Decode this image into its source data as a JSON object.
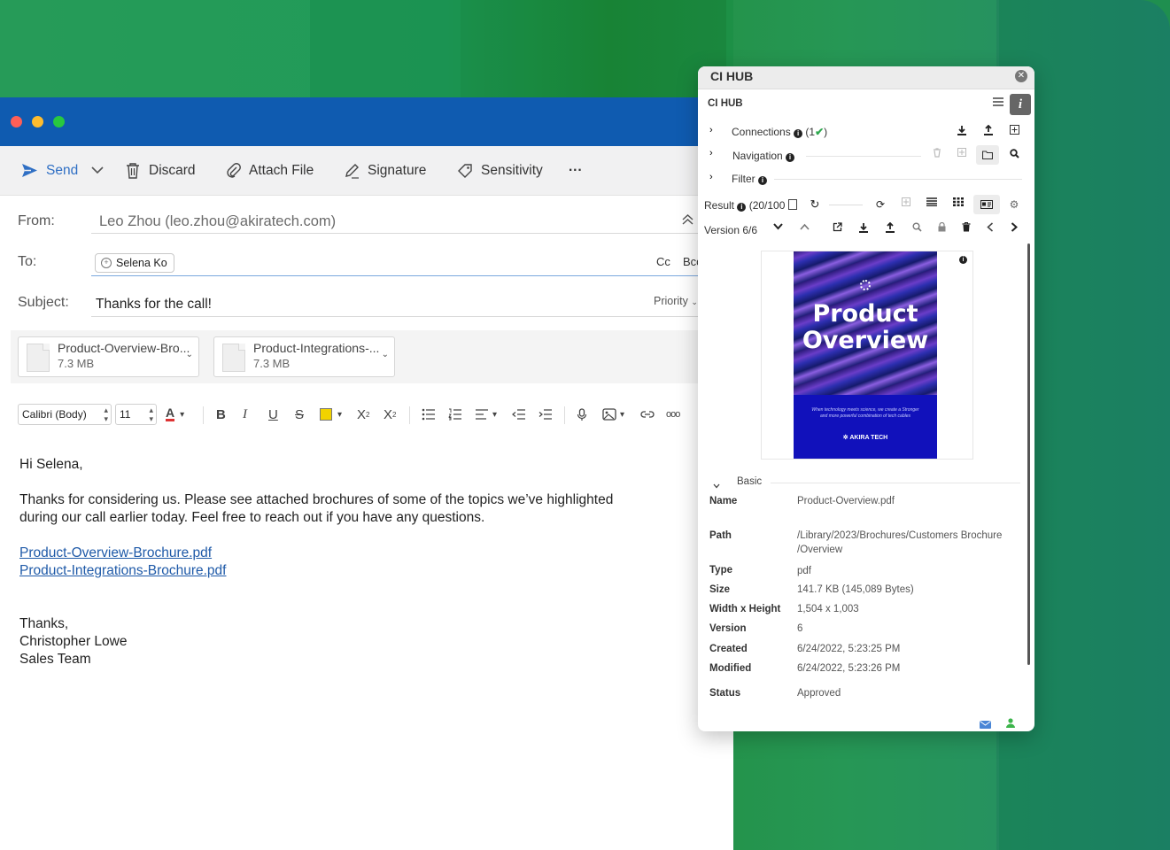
{
  "mail": {
    "toolbar": {
      "send": "Send",
      "discard": "Discard",
      "attach": "Attach File",
      "signature": "Signature",
      "sensitivity": "Sensitivity",
      "more": "···"
    },
    "from": {
      "label": "From:",
      "value": "Leo Zhou (leo.zhou@akiratech.com)"
    },
    "to": {
      "label": "To:",
      "recipient": "Selena Ko",
      "cc": "Cc",
      "bcc": "Bcc"
    },
    "subject": {
      "label": "Subject:",
      "value": "Thanks for the call!",
      "priority": "Priority"
    },
    "attachments": [
      {
        "name": "Product-Overview-Bro...",
        "size": "7.3 MB"
      },
      {
        "name": "Product-Integrations-...",
        "size": "7.3 MB"
      }
    ],
    "format": {
      "font": "Calibri (Body)",
      "size": "11"
    },
    "body": {
      "greeting": "Hi Selena,",
      "line1": "Thanks for considering us. Please see attached brochures of some of the topics we’ve highlighted",
      "line2": "during our call earlier today. Feel free to reach out if you have any questions.",
      "link1": "Product-Overview-Brochure.pdf",
      "link2": "Product-Integrations-Brochure.pdf",
      "closing": "Thanks,",
      "name": "Christopher Lowe",
      "team": "Sales Team"
    }
  },
  "hub": {
    "window_title": "CI HUB",
    "title": "CI HUB",
    "connections": "Connections",
    "connections_count": "(1",
    "connections_close": ")",
    "navigation": "Navigation",
    "filter": "Filter",
    "result": "Result",
    "result_count": "(20/100",
    "version": "Version 6/6",
    "preview": {
      "title_line1": "Product",
      "title_line2": "Overview",
      "tagline": "When technology meets science, we create a Stronger and more powerful combination of tech cables",
      "brand": "AKIRA TECH"
    },
    "section": "Basic",
    "meta": [
      {
        "key": "Name",
        "value": "Product-Overview.pdf"
      },
      {
        "key": "Path",
        "value": "/Library/2023/Brochures/Customers Brochure"
      },
      {
        "key": "",
        "value": "/Overview"
      },
      {
        "key": "Type",
        "value": "pdf"
      },
      {
        "key": "Size",
        "value": "141.7 KB (145,089 Bytes)"
      },
      {
        "key": "Width x Height",
        "value": "1,504 x 1,003"
      },
      {
        "key": "Version",
        "value": "6"
      },
      {
        "key": "Created",
        "value": "6/24/2022, 5:23:25 PM"
      },
      {
        "key": "Modified",
        "value": "6/24/2022, 5:23:26 PM"
      },
      {
        "key": "Status",
        "value": "Approved"
      }
    ]
  }
}
